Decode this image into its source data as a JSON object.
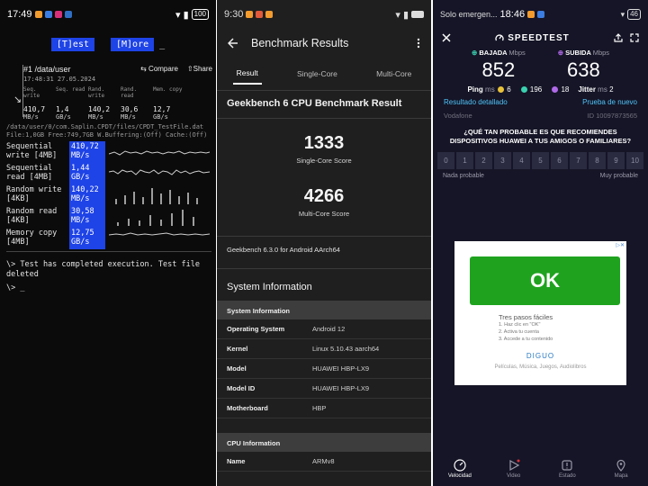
{
  "phone1": {
    "status": {
      "time": "17:49",
      "battery": "100"
    },
    "buttons": {
      "test": "[T]est",
      "more": "[M]ore",
      "cursor": "_"
    },
    "result": {
      "title": "#1 /data/user",
      "compare": "⇆ Compare",
      "share": "⇧Share",
      "date": "17:48:31 27.05.2024",
      "columns": [
        {
          "label": "Seq. write",
          "value": "410,7",
          "unit": "MB/s"
        },
        {
          "label": "Seq. read",
          "value": "1,4",
          "unit": "GB/s"
        },
        {
          "label": "Rand. write",
          "value": "140,2",
          "unit": "MB/s"
        },
        {
          "label": "Rand. read",
          "value": "30,6",
          "unit": "MB/s"
        },
        {
          "label": "Mem. copy",
          "value": "12,7",
          "unit": "GB/s"
        }
      ]
    },
    "file_line1": "/data/user/0/com.Saplin.CPDT/files/CPDT_TestFile.dat",
    "file_line2": "File:1,0GB Free:749,7GB W.Buffering:(Off) Cache:(Off)",
    "bench": [
      {
        "name1": "Sequential",
        "name2": "write [4MB]",
        "val1": "410,72",
        "val2": "MB/s"
      },
      {
        "name1": "Sequential",
        "name2": "read [4MB]",
        "val1": "1,44",
        "val2": "GB/s"
      },
      {
        "name1": "Random write",
        "name2": "[4KB]",
        "val1": "140,22",
        "val2": "MB/s"
      },
      {
        "name1": "Random read",
        "name2": "[4KB]",
        "val1": "30,58",
        "val2": "MB/s"
      },
      {
        "name1": "Memory copy",
        "name2": "[4MB]",
        "val1": "12,75",
        "val2": "GB/s"
      }
    ],
    "message": "\\> Test has completed execution. Test file deleted",
    "prompt": "\\> _"
  },
  "phone2": {
    "status": {
      "time": "9:30"
    },
    "title": "Benchmark Results",
    "tabs": [
      "Result",
      "Single-Core",
      "Multi-Core"
    ],
    "result_title": "Geekbench 6 CPU Benchmark Result",
    "single_score": "1333",
    "single_label": "Single-Core Score",
    "multi_score": "4266",
    "multi_label": "Multi-Core Score",
    "version": "Geekbench 6.3.0 for Android AArch64",
    "sys_title": "System Information",
    "sys_subhead": "System Information",
    "sys_rows": [
      {
        "k": "Operating System",
        "v": "Android 12"
      },
      {
        "k": "Kernel",
        "v": "Linux 5.10.43 aarch64"
      },
      {
        "k": "Model",
        "v": "HUAWEI HBP-LX9"
      },
      {
        "k": "Model ID",
        "v": "HUAWEI HBP-LX9"
      },
      {
        "k": "Motherboard",
        "v": "HBP"
      }
    ],
    "cpu_subhead": "CPU Information",
    "cpu_rows": [
      {
        "k": "Name",
        "v": "ARMv8"
      }
    ]
  },
  "phone3": {
    "status": {
      "left": "Solo emergen...",
      "time": "18:46",
      "battery": "46"
    },
    "logo": "SPEEDTEST",
    "download_label": "BAJADA",
    "upload_label": "SUBIDA",
    "unit": "Mbps",
    "download": "852",
    "upload": "638",
    "ping_label": "Ping",
    "ping_unit": "ms",
    "ping_idle": "6",
    "ping_down": "196",
    "ping_up": "18",
    "jitter_label": "Jitter",
    "jitter": "2",
    "detail_link": "Resultado detallado",
    "retry_link": "Prueba de nuevo",
    "isp": "Vodafone",
    "result_id": "ID 10097873565",
    "question": "¿QUÉ TAN PROBABLE ES QUE RECOMIENDES DISPOSITIVOS HUAWEI A TUS AMIGOS O FAMILIARES?",
    "scale": [
      "0",
      "1",
      "2",
      "3",
      "4",
      "5",
      "6",
      "7",
      "8",
      "9",
      "10"
    ],
    "scale_low": "Nada probable",
    "scale_high": "Muy probable",
    "ad": {
      "ok": "OK",
      "title": "Tres pasos fáciles",
      "steps": [
        "1. Haz clic en \"OK\"",
        "2. Activa tu cuenta",
        "3. Accede a tu contenido"
      ],
      "brand": "DIGUO",
      "footer": "Películas, Música, Juegos, Audiolibros"
    },
    "nav": [
      "Velocidad",
      "Video",
      "Estado",
      "Mapa"
    ],
    "colors": {
      "accent": "#4fc3f7",
      "bg": "#151527",
      "ad_green": "#1fa31f"
    }
  }
}
